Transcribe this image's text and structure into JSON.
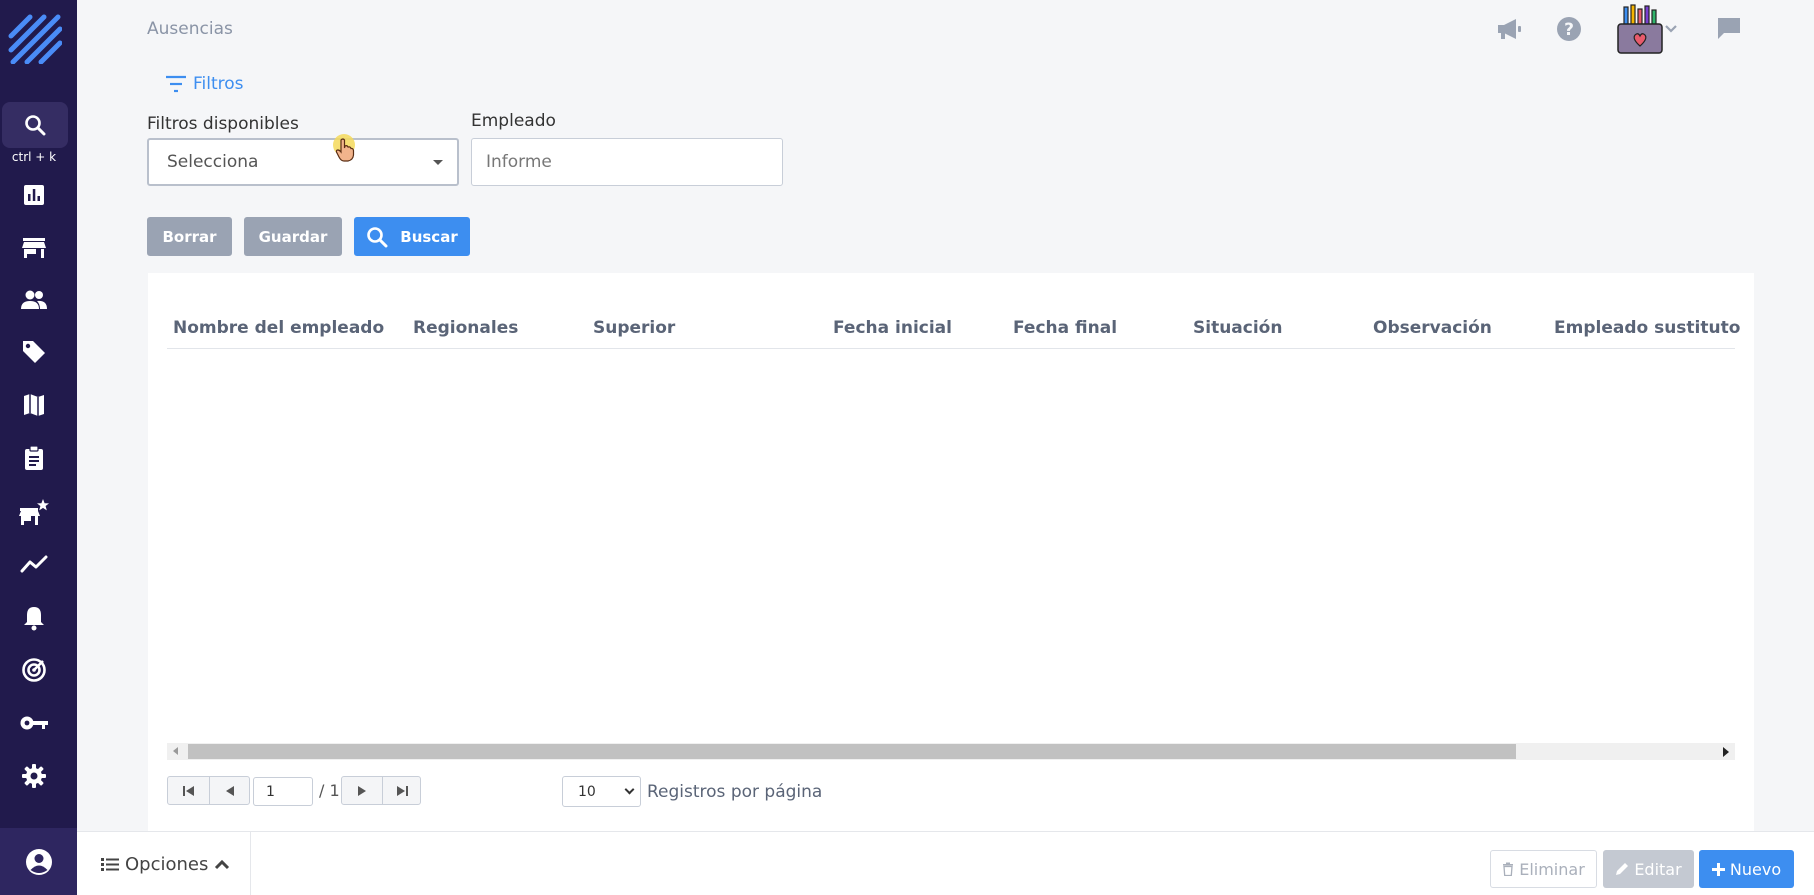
{
  "sidebar": {
    "shortcut": "ctrl + k",
    "icons": [
      "search-icon",
      "chart-icon",
      "store-icon",
      "people-icon",
      "tag-icon",
      "map-icon",
      "clipboard-icon",
      "store-star-icon",
      "trend-icon",
      "bell-icon",
      "radar-icon",
      "key-icon",
      "gear-icon",
      "user-circle-icon"
    ]
  },
  "header": {
    "title": "Ausencias"
  },
  "filters": {
    "toggle_label": "Filtros",
    "available_label": "Filtros disponibles",
    "available_value": "Selecciona",
    "employee_label": "Empleado",
    "employee_placeholder": "Informe"
  },
  "actions": {
    "clear": "Borrar",
    "save": "Guardar",
    "search": "Buscar"
  },
  "table": {
    "columns": [
      "Nombre del empleado",
      "Regionales",
      "Superior",
      "Fecha inicial",
      "Fecha final",
      "Situación",
      "Observación",
      "Empleado sustituto"
    ],
    "rows": []
  },
  "pagination": {
    "page": "1",
    "total": "/ 1",
    "per_page": "10",
    "per_page_label": "Registros por página"
  },
  "footer": {
    "options": "Opciones",
    "delete": "Eliminar",
    "edit": "Editar",
    "new": "Nuevo"
  },
  "colors": {
    "sidebar": "#211a4c",
    "accent": "#3d8ef0",
    "gray_button": "#9aa3b3"
  }
}
